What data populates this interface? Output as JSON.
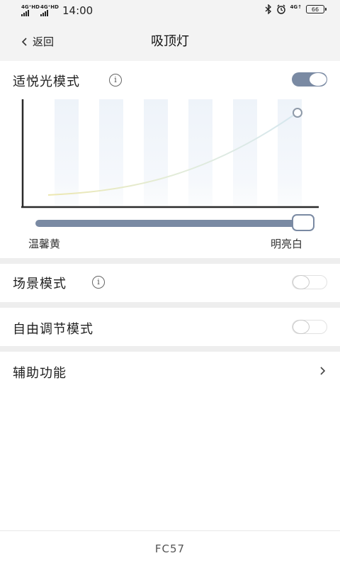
{
  "status_bar": {
    "net1": "4G⁺HD",
    "net2": "4G⁺HD",
    "time": "14:00",
    "net_right": "4G↑",
    "battery": "66"
  },
  "nav": {
    "back_label": "返回",
    "title": "吸顶灯"
  },
  "comfort_mode": {
    "label": "适悦光模式",
    "info_icon": "i",
    "enabled": true
  },
  "color_slider": {
    "min_label": "温馨黄",
    "max_label": "明亮白",
    "value": 1.0
  },
  "scene_mode": {
    "label": "场景模式",
    "info_icon": "i",
    "enabled": false
  },
  "free_mode": {
    "label": "自由调节模式",
    "enabled": false
  },
  "assist": {
    "label": "辅助功能"
  },
  "footer": {
    "model": "FC57"
  },
  "colors": {
    "accent": "#7a8aa3",
    "header_bg": "#f3f3f3",
    "divider": "#eeeeee"
  }
}
